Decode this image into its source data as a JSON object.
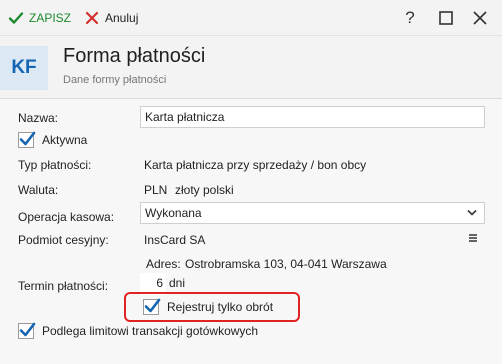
{
  "toolbar": {
    "save_label": "ZAPISZ",
    "cancel_label": "Anuluj",
    "help_glyph": "?",
    "maximize_glyph": "☐",
    "close_glyph": "✕"
  },
  "header": {
    "logo": "KF",
    "title": "Forma płatności",
    "subtitle": "Dane formy płatności"
  },
  "form": {
    "name_label": "Nazwa:",
    "name_value": "Karta płatnicza",
    "active_label": "Aktywna",
    "active_checked": true,
    "payment_type_label": "Typ płatności:",
    "payment_type_value": "Karta płatnicza przy sprzedaży / bon obcy",
    "currency_label": "Waluta:",
    "currency_code": "PLN",
    "currency_name": "złoty polski",
    "cash_op_label": "Operacja kasowa:",
    "cash_op_value": "Wykonana",
    "assignee_label": "Podmiot cesyjny:",
    "assignee_value": "InsCard SA",
    "address_label": "Adres:",
    "address_value": "Ostrobramska 103, 04-041 Warszawa",
    "term_label": "Termin płatności:",
    "term_value": "6",
    "term_unit": "dni",
    "register_turnover_label": "Rejestruj tylko obrót",
    "register_turnover_checked": true,
    "cash_limit_label": "Podlega limitowi transakcji gotówkowych",
    "cash_limit_checked": true
  },
  "colors": {
    "accent": "#1565b3",
    "save_green": "#1d8a2e",
    "cancel_red": "#d32f2f",
    "highlight_red": "#e02323"
  }
}
